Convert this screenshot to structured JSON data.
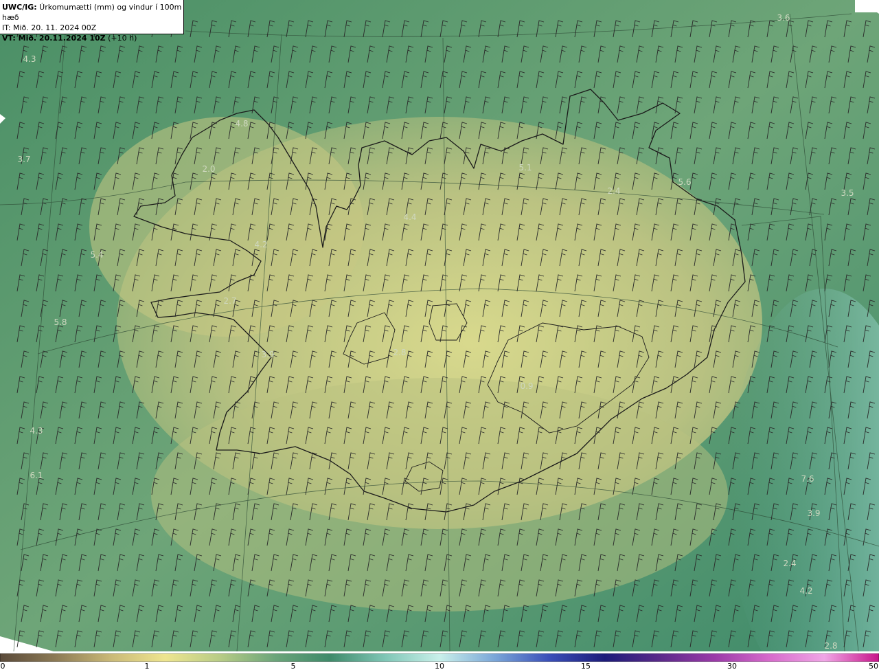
{
  "header": {
    "title_bold": "UWC/IG:",
    "title_rest": " Úrkomumætti (mm) og vindur í 100m hæð",
    "it_line": "IT: Mið. 20. 11. 2024 00Z",
    "vt_bold": "VT: Mið. 20.11.2024 10Z",
    "vt_rest": " (+10 h)"
  },
  "colors": {
    "ocean_deep": "#3f8a62",
    "ocean": "#5a9a6e",
    "land_low": "#a8b878",
    "land_high": "#e6e095",
    "coast": "#1a1a1a",
    "barb": "#2a2a2a",
    "label": "#cfd8c0"
  },
  "colorbar": {
    "ticks": [
      {
        "value": 0,
        "label": "0"
      },
      {
        "value": 1,
        "label": "1"
      },
      {
        "value": 5,
        "label": "5"
      },
      {
        "value": 10,
        "label": "10"
      },
      {
        "value": 15,
        "label": "15"
      },
      {
        "value": 30,
        "label": "30"
      },
      {
        "value": 50,
        "label": "50"
      }
    ],
    "stops": [
      "#5a4a3a",
      "#8c7a55",
      "#c9b877",
      "#eee58f",
      "#b8cc86",
      "#6ba57a",
      "#3f8a6a",
      "#7fc6b6",
      "#c9f0ea",
      "#7aa6d8",
      "#3a4fb8",
      "#1d1c7a",
      "#5a2a8a",
      "#9a3aa8",
      "#d66acb",
      "#f0a6e6",
      "#c7148a"
    ]
  },
  "map_labels": [
    "3.6",
    "4.3",
    "4.8",
    "3.7",
    "2.0",
    "5.1",
    "2.4",
    "5.6",
    "3.5",
    "4.4",
    "5.4",
    "4.2",
    "5.8",
    "2.7",
    "3.9",
    "2.8",
    "0.9",
    "4.3",
    "6.1",
    "7.6",
    "3.9",
    "2.4",
    "4.2",
    "2.8"
  ]
}
